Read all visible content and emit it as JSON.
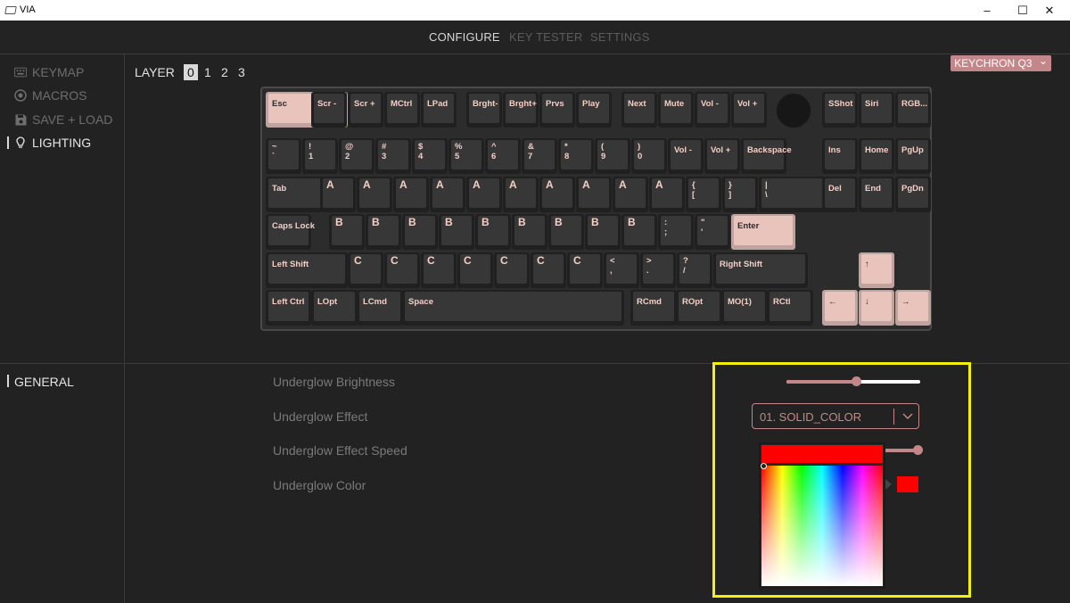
{
  "window": {
    "title": "VIA",
    "minimize": "–",
    "maximize": "☐",
    "close": "✕"
  },
  "nav": {
    "tabs": [
      "CONFIGURE",
      "KEY TESTER",
      "SETTINGS"
    ],
    "active": "CONFIGURE"
  },
  "sidebar": {
    "items": [
      {
        "label": "KEYMAP",
        "icon": "keyboard-icon"
      },
      {
        "label": "MACROS",
        "icon": "record-icon"
      },
      {
        "label": "SAVE + LOAD",
        "icon": "floppy-disk-icon"
      },
      {
        "label": "LIGHTING",
        "icon": "lightbulb-icon"
      }
    ],
    "active": "LIGHTING"
  },
  "layer": {
    "label": "LAYER",
    "options": [
      "0",
      "1",
      "2",
      "3"
    ],
    "selected": "0"
  },
  "keyboard_select": {
    "label": "KEYCHRON Q3",
    "chevron": "⌄"
  },
  "keyboard": {
    "rows": [
      [
        "Esc",
        "Scr -",
        "Scr +",
        "MCtrl",
        "LPad",
        "Brght-",
        "Brght+",
        "Prvs",
        "Play",
        "Next",
        "Mute",
        "Vol -",
        "Vol +",
        "SShot",
        "Siri",
        "RGB..."
      ],
      [
        "~\n`",
        "!\n1",
        "@\n2",
        "#\n3",
        "$\n4",
        "%\n5",
        "^\n6",
        "&\n7",
        "*\n8",
        "(\n9",
        ")\n0",
        "Vol -",
        "Vol +",
        "Backspace",
        "Ins",
        "Home",
        "PgUp"
      ],
      [
        "Tab",
        "A",
        "A",
        "A",
        "A",
        "A",
        "A",
        "A",
        "A",
        "A",
        "A",
        "{\n[",
        "}\n]",
        "|\n\\",
        "Del",
        "End",
        "PgDn"
      ],
      [
        "Caps Lock",
        "B",
        "B",
        "B",
        "B",
        "B",
        "B",
        "B",
        "B",
        "B",
        ":\n;",
        "\"\n'",
        "Enter"
      ],
      [
        "Left Shift",
        "C",
        "C",
        "C",
        "C",
        "C",
        "C",
        "C",
        "<\n,",
        ">\n.",
        "?\n/",
        "Right Shift",
        "↑"
      ],
      [
        "Left Ctrl",
        "LOpt",
        "LCmd",
        "Space",
        "RCmd",
        "ROpt",
        "MO(1)",
        "RCtl",
        "←",
        "↓",
        "→"
      ]
    ]
  },
  "settings_section": {
    "label": "GENERAL"
  },
  "settings": {
    "brightness_label": "Underglow Brightness",
    "brightness_value": 0.52,
    "effect_label": "Underglow Effect",
    "effect_value": "01. SOLID_COLOR",
    "effect_chevron": "⌄",
    "speed_label": "Underglow Effect Speed",
    "speed_value": 1.0,
    "color_label": "Underglow Color",
    "color_value": "#ff0000"
  },
  "colors": {
    "accent": "#c48789",
    "highlight": "#f5f00a",
    "legend": "#f3cfc6"
  }
}
